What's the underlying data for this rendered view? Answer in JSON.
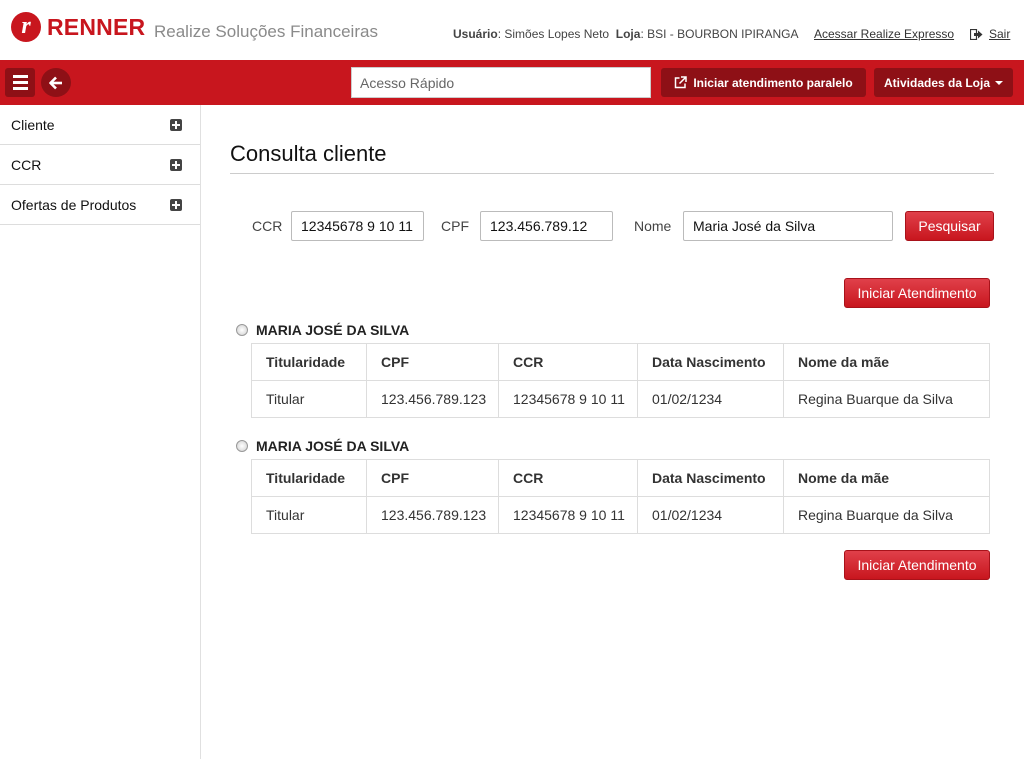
{
  "header": {
    "brand_letter": "r",
    "brand": "RENNER",
    "subtitle": "Realize Soluções Financeiras",
    "user_label": "Usuário",
    "user_value": ": Simões Lopes Neto",
    "store_label": "Loja",
    "store_value": ": BSI - BOURBON IPIRANGA",
    "express_link": "Acessar Realize Expresso",
    "logout": "Sair"
  },
  "nav": {
    "quick_placeholder": "Acesso Rápido",
    "parallel_button": "Iniciar atendimento paralelo",
    "activities_button": "Atividades da Loja"
  },
  "sidebar": {
    "items": [
      {
        "label": "Cliente"
      },
      {
        "label": "CCR"
      },
      {
        "label": "Ofertas de Produtos"
      }
    ]
  },
  "main": {
    "title": "Consulta cliente",
    "search": {
      "ccr_label": "CCR",
      "ccr_value": "12345678 9 10 11",
      "cpf_label": "CPF",
      "cpf_value": "123.456.789.12",
      "name_label": "Nome",
      "name_value": "Maria José da Silva",
      "search_button": "Pesquisar"
    },
    "start_button": "Iniciar Atendimento",
    "columns": [
      "Titularidade",
      "CPF",
      "CCR",
      "Data Nascimento",
      "Nome da mãe"
    ],
    "results": [
      {
        "name": "MARIA JOSÉ DA SILVA",
        "row": [
          "Titular",
          "123.456.789.123",
          "12345678 9 10 11",
          "01/02/1234",
          "Regina Buarque da Silva"
        ]
      },
      {
        "name": "MARIA JOSÉ DA SILVA",
        "row": [
          "Titular",
          "123.456.789.123",
          "12345678 9 10 11",
          "01/02/1234",
          "Regina Buarque da Silva"
        ]
      }
    ]
  },
  "colors": {
    "brand_red": "#c8161e",
    "dark_red": "#8e1016"
  }
}
